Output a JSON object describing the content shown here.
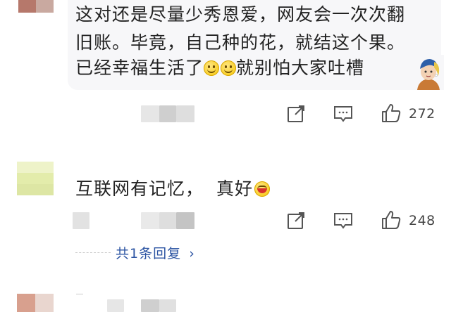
{
  "comments": [
    {
      "lines": [
        "这对还是尽量少秀恩爱，网友会一次次翻",
        "旧账。毕竟，自己种的花，就结这个果。",
        "已经幸福生活了",
        "就别怕大家吐槽"
      ],
      "emojis": [
        "smile",
        "smile"
      ],
      "sticker": "girl-with-pearl-earring-sticker",
      "likes": "272"
    },
    {
      "text_a": "互联网有记忆，",
      "text_b": "真好",
      "emoji": "laugh",
      "likes": "248",
      "replies_label": "共1条回复",
      "replies_chevron": "›"
    }
  ],
  "icons": {
    "share": "share-icon",
    "comment": "comment-icon",
    "like": "thumbs-up-icon",
    "chevron": "chevron-right-icon"
  },
  "colors": {
    "link": "#2d55a3",
    "bubble_bg": "#f7f7f9",
    "avatar_yellow": "#e7efb4"
  }
}
